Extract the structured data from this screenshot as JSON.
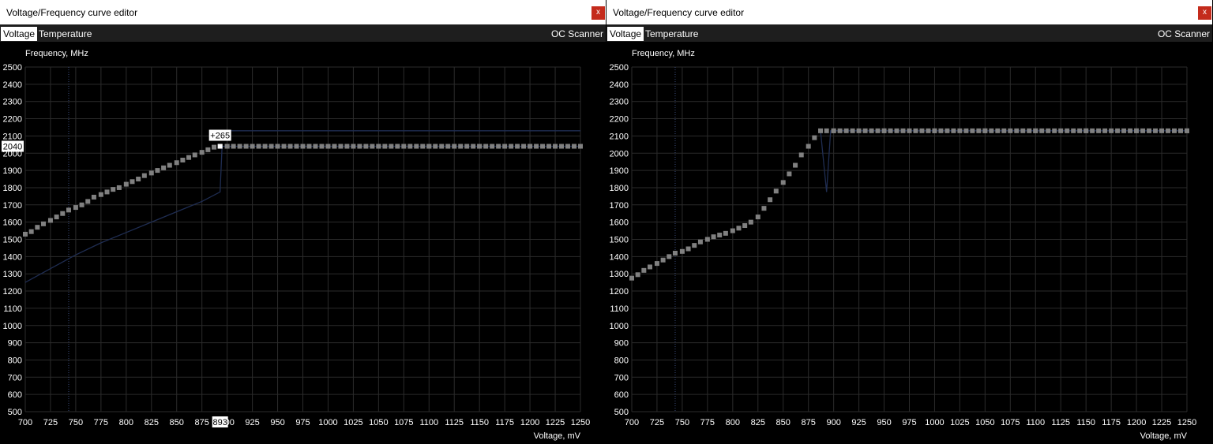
{
  "panels": [
    {
      "title": "Voltage/Frequency curve editor",
      "close_label": "x",
      "tabs": [
        {
          "label": "Voltage",
          "active": true
        },
        {
          "label": "Temperature",
          "active": false
        }
      ],
      "scanner_label": "OC Scanner",
      "selected": {
        "voltage_label": "893",
        "frequency_label": "2040",
        "offset_label": "+265"
      }
    },
    {
      "title": "Voltage/Frequency curve editor",
      "close_label": "x",
      "tabs": [
        {
          "label": "Voltage",
          "active": true
        },
        {
          "label": "Temperature",
          "active": false
        }
      ],
      "scanner_label": "OC Scanner",
      "selected": null
    }
  ],
  "colors": {
    "background": "#000000",
    "grid": "#2b2b2b",
    "reference_line": "#1f2d52",
    "points": "#808080",
    "selected_point": "#ffffff",
    "close_button": "#c42b1c"
  },
  "chart_data": [
    {
      "type": "scatter",
      "title": "",
      "ylabel": "Frequency, MHz",
      "xlabel": "Voltage, mV",
      "xlim": [
        700,
        1250
      ],
      "ylim": [
        500,
        2500
      ],
      "grid": true,
      "x_ticks": [
        700,
        725,
        750,
        775,
        800,
        825,
        850,
        875,
        900,
        925,
        950,
        975,
        1000,
        1025,
        1050,
        1075,
        1100,
        1125,
        1150,
        1175,
        1200,
        1225,
        1250
      ],
      "y_ticks": [
        500,
        600,
        700,
        800,
        900,
        1000,
        1100,
        1200,
        1300,
        1400,
        1500,
        1600,
        1700,
        1800,
        1900,
        2000,
        2100,
        2200,
        2300,
        2400,
        2500
      ],
      "marker_voltage": 743,
      "series": [
        {
          "kind": "points",
          "x": [
            700,
            706,
            712,
            718,
            725,
            731,
            737,
            743,
            750,
            756,
            762,
            768,
            775,
            781,
            787,
            793,
            800,
            806,
            812,
            818,
            825,
            831,
            837,
            843,
            850,
            856,
            862,
            868,
            875,
            881,
            887,
            893,
            900,
            950,
            1000,
            1050,
            1100,
            1150,
            1200,
            1250
          ],
          "y": [
            1530,
            1545,
            1570,
            1590,
            1610,
            1630,
            1650,
            1670,
            1685,
            1700,
            1720,
            1745,
            1760,
            1775,
            1790,
            1800,
            1820,
            1835,
            1850,
            1870,
            1885,
            1900,
            1915,
            1930,
            1945,
            1960,
            1975,
            1990,
            2005,
            2020,
            2035,
            2040,
            2040,
            2040,
            2040,
            2040,
            2040,
            2040,
            2040,
            2040
          ]
        },
        {
          "kind": "reference",
          "x": [
            700,
            725,
            750,
            775,
            800,
            825,
            850,
            875,
            893,
            895,
            900,
            1000,
            1100,
            1200,
            1250
          ],
          "y": [
            1250,
            1330,
            1410,
            1480,
            1540,
            1600,
            1660,
            1720,
            1775,
            2040,
            2040,
            2040,
            2040,
            2040,
            2040
          ]
        },
        {
          "kind": "reference",
          "x": [
            893,
            1250
          ],
          "y": [
            2130,
            2130
          ]
        }
      ],
      "selected_point": {
        "x": 893,
        "y": 2040
      }
    },
    {
      "type": "scatter",
      "title": "",
      "ylabel": "Frequency, MHz",
      "xlabel": "Voltage, mV",
      "xlim": [
        700,
        1250
      ],
      "ylim": [
        500,
        2500
      ],
      "grid": true,
      "x_ticks": [
        700,
        725,
        750,
        775,
        800,
        825,
        850,
        875,
        900,
        925,
        950,
        975,
        1000,
        1025,
        1050,
        1075,
        1100,
        1125,
        1150,
        1175,
        1200,
        1225,
        1250
      ],
      "y_ticks": [
        500,
        600,
        700,
        800,
        900,
        1000,
        1100,
        1200,
        1300,
        1400,
        1500,
        1600,
        1700,
        1800,
        1900,
        2000,
        2100,
        2200,
        2300,
        2400,
        2500
      ],
      "marker_voltage": 743,
      "series": [
        {
          "kind": "points",
          "x": [
            700,
            706,
            712,
            718,
            725,
            731,
            737,
            743,
            750,
            756,
            762,
            768,
            775,
            781,
            787,
            793,
            800,
            806,
            812,
            818,
            825,
            831,
            837,
            843,
            850,
            856,
            862,
            868,
            875,
            881,
            887,
            893,
            900,
            950,
            1000,
            1050,
            1100,
            1150,
            1200,
            1250
          ],
          "y": [
            1275,
            1295,
            1320,
            1340,
            1360,
            1380,
            1400,
            1420,
            1430,
            1445,
            1465,
            1485,
            1500,
            1515,
            1525,
            1535,
            1550,
            1565,
            1580,
            1600,
            1630,
            1680,
            1730,
            1780,
            1830,
            1880,
            1930,
            1990,
            2040,
            2090,
            2130,
            2130,
            2130,
            2130,
            2130,
            2130,
            2130,
            2130,
            2130,
            2130
          ]
        },
        {
          "kind": "reference",
          "x": [
            887,
            893,
            897,
            900,
            1000,
            1100,
            1200,
            1250
          ],
          "y": [
            2130,
            1775,
            2130,
            2130,
            2130,
            2130,
            2130,
            2130
          ]
        }
      ],
      "selected_point": null
    }
  ]
}
